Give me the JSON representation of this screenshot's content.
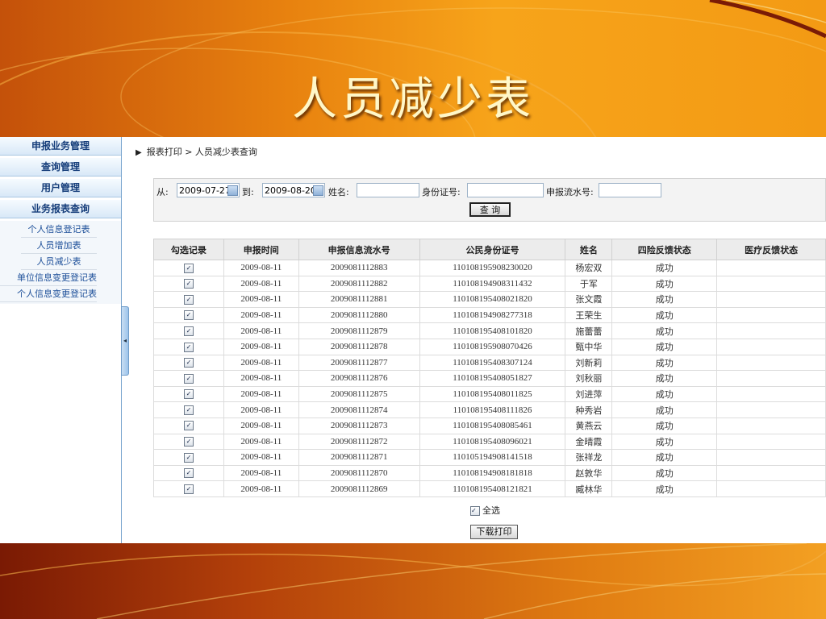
{
  "slide": {
    "title": "人员减少表"
  },
  "sidebar": {
    "menus": [
      {
        "label": "申报业务管理"
      },
      {
        "label": "查询管理"
      },
      {
        "label": "用户管理"
      },
      {
        "label": "业务报表查询"
      }
    ],
    "subitems": [
      {
        "label": "个人信息登记表"
      },
      {
        "label": "人员增加表"
      },
      {
        "label": "人员减少表"
      },
      {
        "label": "单位信息变更登记表"
      },
      {
        "label": "个人信息变更登记表"
      }
    ],
    "collapse_icon": "◂"
  },
  "breadcrumb": {
    "arrow": "▶",
    "text": "报表打印 > 人员减少表查询"
  },
  "search": {
    "from_label": "从:",
    "from_value": "2009-07-27",
    "to_label": "到:",
    "to_value": "2009-08-20",
    "name_label": "姓名:",
    "name_value": "",
    "id_label": "身份证号:",
    "id_value": "",
    "serial_label": "申报流水号:",
    "serial_value": "",
    "query_button": "查 询"
  },
  "table": {
    "headers": [
      "勾选记录",
      "申报时间",
      "申报信息流水号",
      "公民身份证号",
      "姓名",
      "四险反馈状态",
      "医疗反馈状态"
    ],
    "rows": [
      {
        "checked": "✓",
        "date": "2009-08-11",
        "serial": "2009081112883",
        "id": "110108195908230020",
        "name": "杨宏双",
        "status4": "成功",
        "medical": ""
      },
      {
        "checked": "✓",
        "date": "2009-08-11",
        "serial": "2009081112882",
        "id": "110108194908311432",
        "name": "于军",
        "status4": "成功",
        "medical": ""
      },
      {
        "checked": "✓",
        "date": "2009-08-11",
        "serial": "2009081112881",
        "id": "110108195408021820",
        "name": "张文霞",
        "status4": "成功",
        "medical": ""
      },
      {
        "checked": "✓",
        "date": "2009-08-11",
        "serial": "2009081112880",
        "id": "110108194908277318",
        "name": "王荣生",
        "status4": "成功",
        "medical": ""
      },
      {
        "checked": "✓",
        "date": "2009-08-11",
        "serial": "2009081112879",
        "id": "110108195408101820",
        "name": "施蕾蕾",
        "status4": "成功",
        "medical": ""
      },
      {
        "checked": "✓",
        "date": "2009-08-11",
        "serial": "2009081112878",
        "id": "110108195908070426",
        "name": "甄中华",
        "status4": "成功",
        "medical": ""
      },
      {
        "checked": "✓",
        "date": "2009-08-11",
        "serial": "2009081112877",
        "id": "110108195408307124",
        "name": "刘新莉",
        "status4": "成功",
        "medical": ""
      },
      {
        "checked": "✓",
        "date": "2009-08-11",
        "serial": "2009081112876",
        "id": "110108195408051827",
        "name": "刘秋丽",
        "status4": "成功",
        "medical": ""
      },
      {
        "checked": "✓",
        "date": "2009-08-11",
        "serial": "2009081112875",
        "id": "110108195408011825",
        "name": "刘进萍",
        "status4": "成功",
        "medical": ""
      },
      {
        "checked": "✓",
        "date": "2009-08-11",
        "serial": "2009081112874",
        "id": "110108195408111826",
        "name": "种秀岩",
        "status4": "成功",
        "medical": ""
      },
      {
        "checked": "✓",
        "date": "2009-08-11",
        "serial": "2009081112873",
        "id": "110108195408085461",
        "name": "黄燕云",
        "status4": "成功",
        "medical": ""
      },
      {
        "checked": "✓",
        "date": "2009-08-11",
        "serial": "2009081112872",
        "id": "110108195408096021",
        "name": "金晴霞",
        "status4": "成功",
        "medical": ""
      },
      {
        "checked": "✓",
        "date": "2009-08-11",
        "serial": "2009081112871",
        "id": "110105194908141518",
        "name": "张祥龙",
        "status4": "成功",
        "medical": ""
      },
      {
        "checked": "✓",
        "date": "2009-08-11",
        "serial": "2009081112870",
        "id": "110108194908181818",
        "name": "赵敦华",
        "status4": "成功",
        "medical": ""
      },
      {
        "checked": "✓",
        "date": "2009-08-11",
        "serial": "2009081112869",
        "id": "110108195408121821",
        "name": "臧林华",
        "status4": "成功",
        "medical": ""
      }
    ]
  },
  "footer": {
    "select_all_check": "✓",
    "select_all_label": "全选",
    "download_button": "下载打印"
  }
}
